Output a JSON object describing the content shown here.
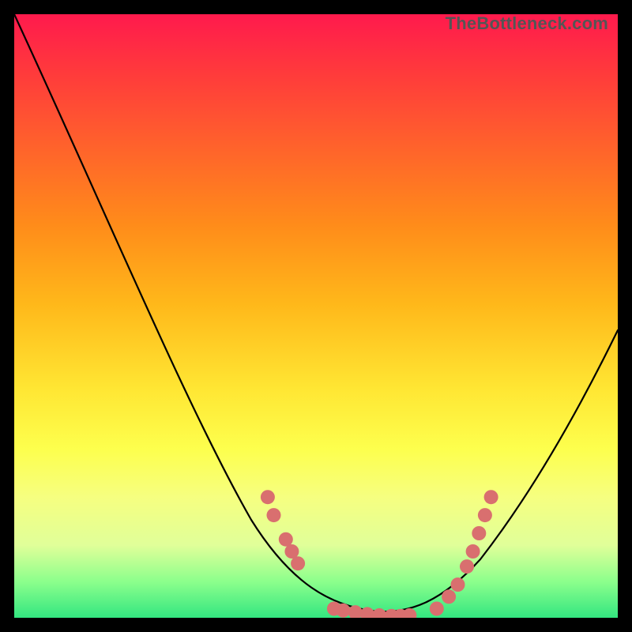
{
  "watermark": "TheBottleneck.com",
  "chart_data": {
    "type": "line",
    "title": "",
    "xlabel": "",
    "ylabel": "",
    "x": [
      0.0,
      0.05,
      0.1,
      0.15,
      0.2,
      0.25,
      0.3,
      0.35,
      0.4,
      0.45,
      0.5,
      0.55,
      0.6,
      0.65,
      0.7,
      0.75,
      0.8,
      0.85,
      0.9,
      0.95,
      1.0
    ],
    "series": [
      {
        "name": "curve",
        "values": [
          1.0,
          0.86,
          0.72,
          0.58,
          0.44,
          0.32,
          0.22,
          0.14,
          0.08,
          0.04,
          0.02,
          0.01,
          0.0,
          0.0,
          0.01,
          0.03,
          0.08,
          0.16,
          0.26,
          0.38,
          0.5
        ]
      }
    ],
    "markers": {
      "name": "highlight-dots",
      "color": "#d96f6f",
      "points": [
        {
          "x": 0.42,
          "y": 0.2
        },
        {
          "x": 0.43,
          "y": 0.17
        },
        {
          "x": 0.45,
          "y": 0.13
        },
        {
          "x": 0.46,
          "y": 0.11
        },
        {
          "x": 0.47,
          "y": 0.09
        },
        {
          "x": 0.53,
          "y": 0.015
        },
        {
          "x": 0.545,
          "y": 0.012
        },
        {
          "x": 0.565,
          "y": 0.009
        },
        {
          "x": 0.585,
          "y": 0.006
        },
        {
          "x": 0.605,
          "y": 0.004
        },
        {
          "x": 0.625,
          "y": 0.003
        },
        {
          "x": 0.64,
          "y": 0.003
        },
        {
          "x": 0.655,
          "y": 0.004
        },
        {
          "x": 0.7,
          "y": 0.015
        },
        {
          "x": 0.72,
          "y": 0.035
        },
        {
          "x": 0.735,
          "y": 0.055
        },
        {
          "x": 0.75,
          "y": 0.085
        },
        {
          "x": 0.76,
          "y": 0.11
        },
        {
          "x": 0.77,
          "y": 0.14
        },
        {
          "x": 0.78,
          "y": 0.17
        },
        {
          "x": 0.79,
          "y": 0.2
        }
      ]
    },
    "xlim": [
      0,
      1
    ],
    "ylim": [
      0,
      1
    ],
    "grid": false,
    "legend": false
  }
}
